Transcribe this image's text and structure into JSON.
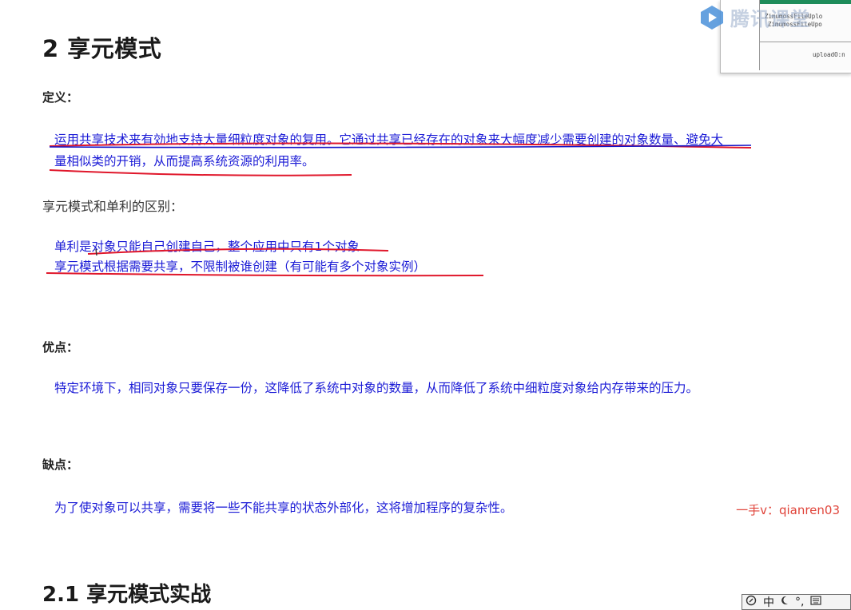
{
  "title": "2 享元模式",
  "definition": {
    "label": "定义：",
    "line1": "运用共享技术来有効地支持大量细粒度对象的复用。它通过共享已经存在的对象来大幅度减少需要创建的对象数量、避免大",
    "line2": "量相似类的开销，从而提高系统资源的利用率。"
  },
  "difference": {
    "heading": "享元模式和单利的区别：",
    "line1": "单利是对象只能自己创建自己，整个应用中只有1个对象",
    "line2": "享元模式根据需要共享，不限制被谁创建（有可能有多个对象实例）"
  },
  "advantages": {
    "label": "优点：",
    "text": "特定环境下，相同对象只要保存一份，这降低了系统中对象的数量，从而降低了系统中细粒度对象给内存带来的压力。"
  },
  "disadvantages": {
    "label": "缺点：",
    "text": "为了使对象可以共享，需要将一些不能共享的状态外部化，这将增加程序的复杂性。"
  },
  "watermark": "一手v：qianren03",
  "subtitle": "2.1 享元模式实战",
  "overlay": {
    "logo_text": "腾讯课堂",
    "code_line1": "ZimumossFileUplo",
    "code_line2": "ZimumossFileUpo",
    "code_line3": "uploadO:n"
  },
  "ime": {
    "lang": "中",
    "punct": "°,"
  },
  "colors": {
    "blue_text": "#1b1bd6",
    "red_ink": "#e0172b",
    "blue_ink": "#1515c8",
    "watermark": "#e0443a"
  }
}
